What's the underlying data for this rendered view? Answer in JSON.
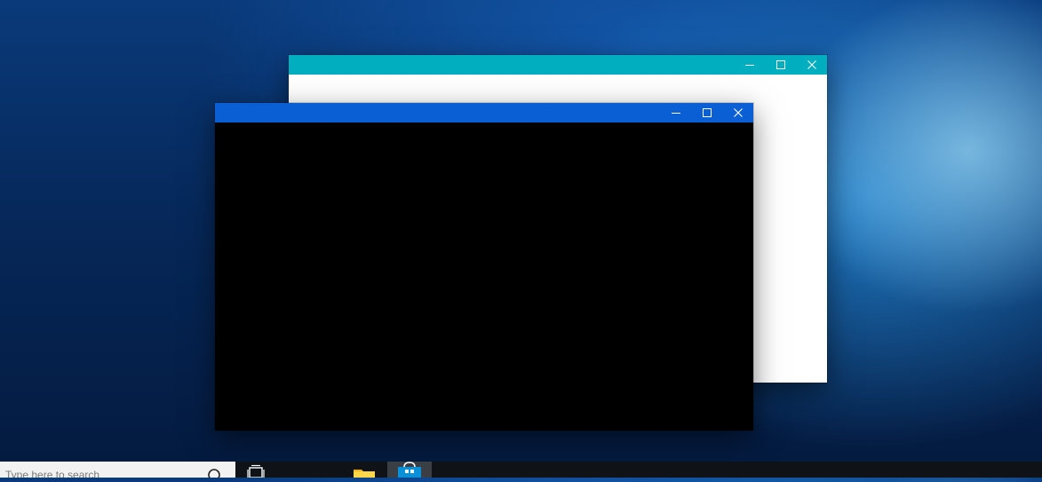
{
  "desktop": {
    "back_window": {
      "titlebar_color": "#00afbf",
      "controls": [
        "minimize-icon",
        "maximize-icon",
        "close-icon"
      ]
    },
    "front_window": {
      "titlebar_color": "#0a5fd4",
      "controls": [
        "minimize-icon",
        "maximize-icon",
        "close-icon"
      ]
    }
  },
  "taskbar": {
    "search": {
      "placeholder": "Type here to search"
    },
    "icons": [
      "search-icon",
      "task-view-icon",
      "file-explorer-icon",
      "store-icon"
    ]
  }
}
